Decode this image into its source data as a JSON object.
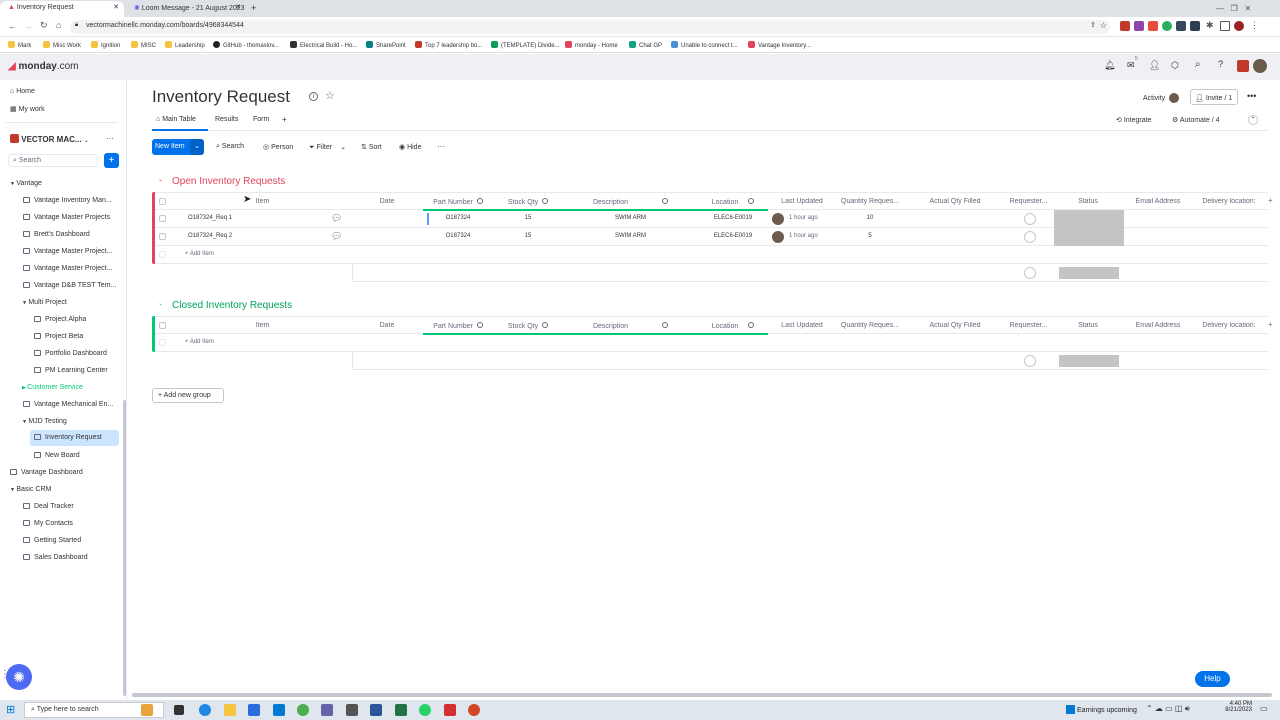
{
  "browser": {
    "tabs": [
      {
        "label": "Inventory Request"
      },
      {
        "label": "Loom Message - 21 August 2023"
      }
    ],
    "url": "vectormachinellc.monday.com/boards/4968344544",
    "bookmarks": [
      "Mark",
      "Misc Work",
      "Ignition",
      "MISC",
      "Leadership",
      "GitHub - thomaslov...",
      "Electrical Build - Ho...",
      "SharePoint",
      "Top 7 leadership bo...",
      "(TEMPLATE) Divide...",
      "monday - Home",
      "Chat GP",
      "Unable to connect t...",
      "Vantage Inventory..."
    ]
  },
  "app": {
    "logo_text": "monday",
    "logo_suffix": ".com",
    "notif_badge": "5"
  },
  "sidebar": {
    "home": "Home",
    "my_work": "My work",
    "workspace": "VECTOR MAC...",
    "search_placeholder": "Search",
    "items": [
      {
        "label": "Vantage"
      },
      {
        "label": "Vantage Inventory Man..."
      },
      {
        "label": "Vantage Master Projects"
      },
      {
        "label": "Brett's Dashboard"
      },
      {
        "label": "Vantage Master Project..."
      },
      {
        "label": "Vantage Master Project..."
      },
      {
        "label": "Vantage D&B TEST Tem..."
      },
      {
        "label": "Multi Project"
      },
      {
        "label": "Project Alpha"
      },
      {
        "label": "Project Beta"
      },
      {
        "label": "Portfolio Dashboard"
      },
      {
        "label": "PM Learning Center"
      },
      {
        "label": "Customer Service"
      },
      {
        "label": "Vantage Mechanical En..."
      },
      {
        "label": "MJD Testing"
      },
      {
        "label": "Inventory Request"
      },
      {
        "label": "New Board"
      },
      {
        "label": "Vantage Dashboard"
      },
      {
        "label": "Basic CRM"
      },
      {
        "label": "Deal Tracker"
      },
      {
        "label": "My Contacts"
      },
      {
        "label": "Getting Started"
      },
      {
        "label": "Sales Dashboard"
      }
    ]
  },
  "board": {
    "title": "Inventory Request",
    "activity": "Activity",
    "invite": "Invite / 1",
    "views": [
      {
        "label": "Main Table"
      },
      {
        "label": "Results"
      },
      {
        "label": "Form"
      },
      {
        "label": "+"
      }
    ],
    "integrate": "Integrate",
    "automate": "Automate / 4",
    "toolbar": {
      "new_item": "New Item",
      "search": "Search",
      "person": "Person",
      "filter": "Filter",
      "sort": "Sort",
      "hide": "Hide"
    },
    "columns": [
      "Item",
      "Date",
      "Part Number",
      "Stock Qty",
      "Description",
      "Location",
      "Last Updated",
      "Quantity Reques...",
      "Actual Qty Filled",
      "Requester...",
      "Status",
      "Email Address",
      "Delivery location:"
    ],
    "groups": [
      {
        "title": "Open Inventory Requests",
        "color": "#e2445c",
        "rows": [
          {
            "item": "O187324_Req 1",
            "part": "O187324",
            "stock": "15",
            "desc": "SWIM ARM",
            "loc": "ELEC6-E0019",
            "updated": "1 hour ago",
            "qty": "10"
          },
          {
            "item": "O187324_Req 2",
            "part": "O187324",
            "stock": "15",
            "desc": "SWIM ARM",
            "loc": "ELEC6-E0019",
            "updated": "1 hour ago",
            "qty": "5"
          }
        ],
        "add_item": "+ Add Item"
      },
      {
        "title": "Closed Inventory Requests",
        "color": "#00c875",
        "rows": [],
        "add_item": "+ Add Item"
      }
    ],
    "add_group": "Add new group"
  },
  "help": "Help",
  "taskbar": {
    "search": "Type here to search",
    "news": "Earnings upcoming",
    "time": "4:40 PM",
    "date": "8/21/2023"
  }
}
